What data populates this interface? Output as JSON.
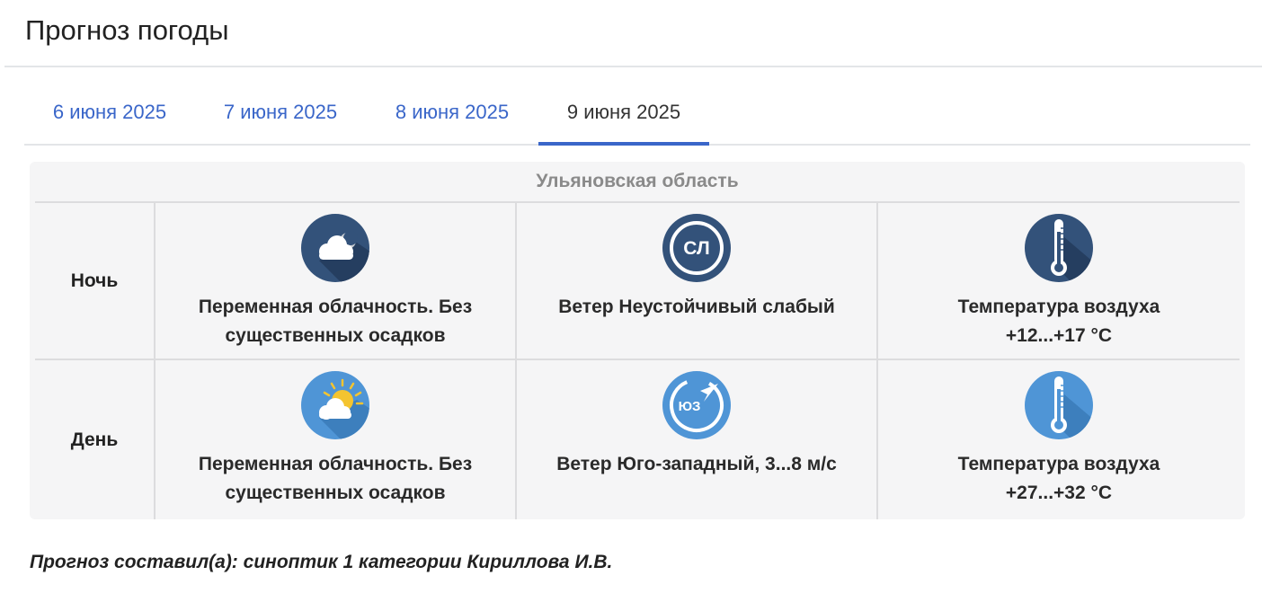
{
  "page": {
    "title": "Прогноз погоды"
  },
  "tabs": [
    {
      "label": "6 июня 2025"
    },
    {
      "label": "7 июня 2025"
    },
    {
      "label": "8 июня 2025"
    },
    {
      "label": "9 июня 2025",
      "active": true
    }
  ],
  "forecast": {
    "region": "Ульяновская область",
    "rows": [
      {
        "period": "Ночь",
        "sky": {
          "icon": "partly-cloudy-night-icon",
          "line1": "Переменная облачность. Без",
          "line2": "существенных осадков"
        },
        "wind": {
          "icon": "wind-variable-icon",
          "badge": "СЛ",
          "line1": "Ветер Неустойчивый слабый",
          "line2": ""
        },
        "temp": {
          "icon": "thermometer-night-icon",
          "line1": "Температура воздуха",
          "line2": "+12...+17 °С"
        }
      },
      {
        "period": "День",
        "sky": {
          "icon": "partly-cloudy-day-icon",
          "line1": "Переменная облачность. Без",
          "line2": "существенных осадков"
        },
        "wind": {
          "icon": "wind-southwest-icon",
          "badge": "ЮЗ",
          "line1": "Ветер Юго-западный, 3...8 м/с",
          "line2": ""
        },
        "temp": {
          "icon": "thermometer-day-icon",
          "line1": "Температура воздуха",
          "line2": "+27...+32 °С"
        }
      }
    ]
  },
  "footer": {
    "author": "Прогноз составил(а): синоптик 1 категории Кириллова И.В."
  },
  "colors": {
    "accent": "#3a66c9",
    "night_icon": "#33527a",
    "day_icon": "#4f95d6"
  }
}
